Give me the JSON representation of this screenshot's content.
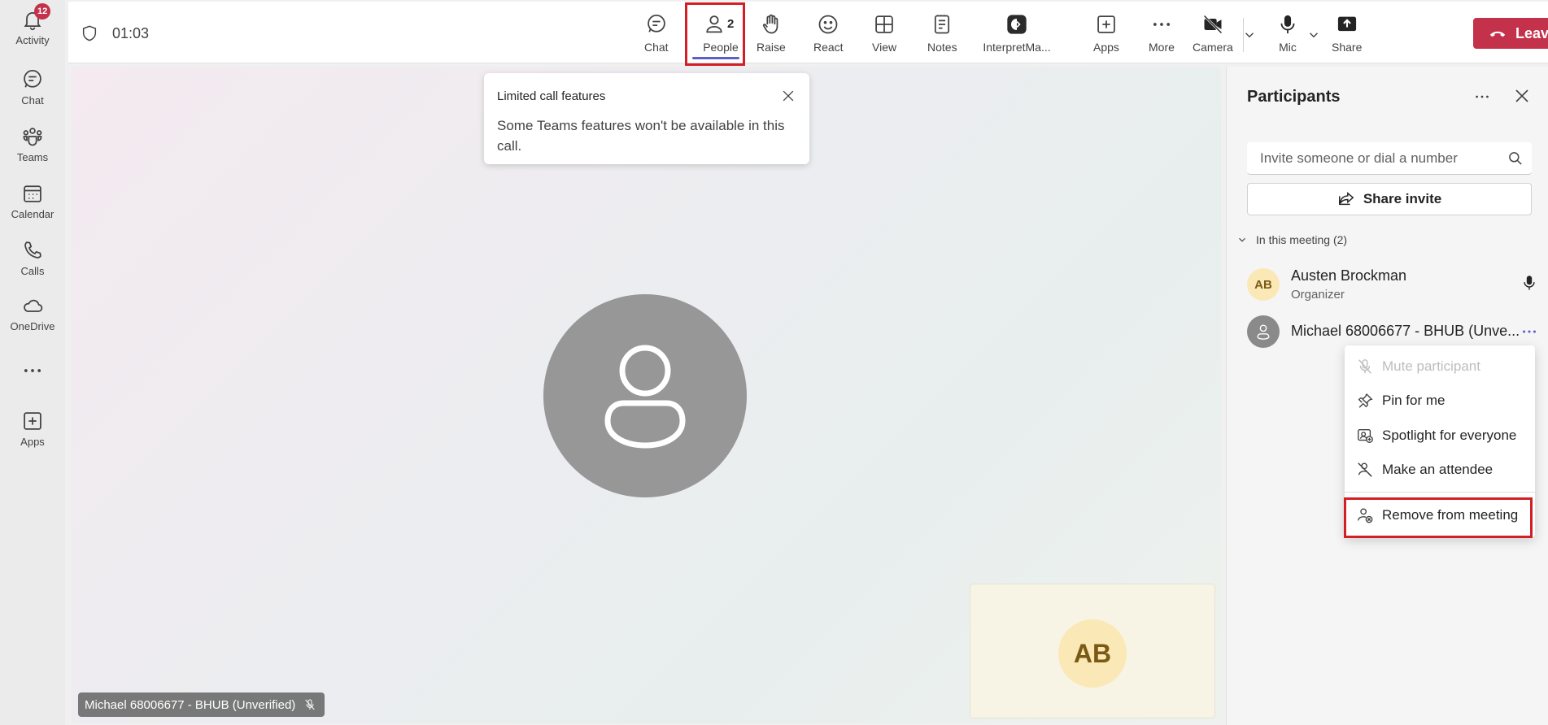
{
  "rail": {
    "items": [
      {
        "label": "Activity",
        "badge": "12",
        "icon": "bell-icon"
      },
      {
        "label": "Chat",
        "icon": "chat-icon"
      },
      {
        "label": "Teams",
        "icon": "teams-icon"
      },
      {
        "label": "Calendar",
        "icon": "calendar-icon"
      },
      {
        "label": "Calls",
        "icon": "phone-icon"
      },
      {
        "label": "OneDrive",
        "icon": "cloud-icon"
      },
      {
        "label": "",
        "icon": "more-icon"
      },
      {
        "label": "Apps",
        "icon": "add-apps-icon"
      }
    ]
  },
  "topbar": {
    "timer": "01:03",
    "buttons": [
      {
        "label": "Chat",
        "icon": "chat-icon"
      },
      {
        "label": "People",
        "count": "2",
        "icon": "people-icon"
      },
      {
        "label": "Raise",
        "icon": "hand-icon"
      },
      {
        "label": "React",
        "icon": "smile-icon"
      },
      {
        "label": "View",
        "icon": "grid-icon"
      },
      {
        "label": "Notes",
        "icon": "notes-icon"
      },
      {
        "label": "InterpretMa...",
        "icon": "interpret-app-icon"
      },
      {
        "label": "Apps",
        "icon": "add-apps-icon"
      },
      {
        "label": "More",
        "icon": "more-icon"
      },
      {
        "label": "Camera",
        "icon": "camera-off-icon"
      },
      {
        "label": "Mic",
        "icon": "mic-icon"
      },
      {
        "label": "Share",
        "icon": "share-screen-icon"
      }
    ],
    "leave_label": "Leave"
  },
  "stage": {
    "name_tag": "Michael 68006677 - BHUB (Unverified)",
    "self_initials": "AB"
  },
  "toast": {
    "title": "Limited call features",
    "body": "Some Teams features won't be available in this call."
  },
  "panel": {
    "title": "Participants",
    "invite_placeholder": "Invite someone or dial a number",
    "share_invite": "Share invite",
    "section": "In this meeting (2)",
    "participants": [
      {
        "initials": "AB",
        "name": "Austen Brockman",
        "role": "Organizer"
      },
      {
        "initials": "",
        "name": "Michael 68006677 - BHUB (Unve...",
        "role": ""
      }
    ]
  },
  "context_menu": {
    "items": [
      {
        "label": "Mute participant",
        "disabled": true
      },
      {
        "label": "Pin for me"
      },
      {
        "label": "Spotlight for everyone"
      },
      {
        "label": "Make an attendee"
      },
      {
        "label": "Remove from meeting"
      }
    ]
  },
  "colors": {
    "accent": "#5b5fc7",
    "leave": "#c4314b",
    "highlight": "#d21f26"
  }
}
